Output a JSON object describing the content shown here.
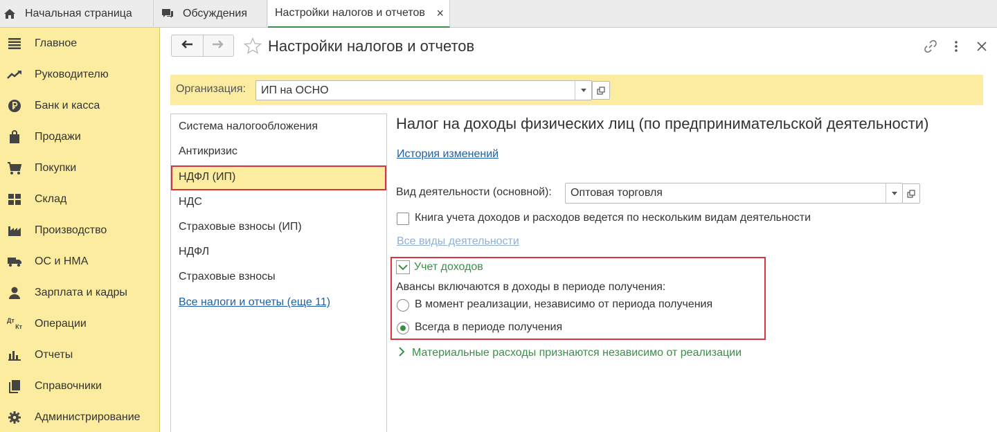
{
  "tabs": {
    "home_label": "Начальная страница",
    "discussions_label": "Обсуждения",
    "active_label": "Настройки налогов и отчетов",
    "close_symbol": "×"
  },
  "sidebar": {
    "items": [
      {
        "label": "Главное",
        "icon": "menu-icon"
      },
      {
        "label": "Руководителю",
        "icon": "trend-icon"
      },
      {
        "label": "Банк и касса",
        "icon": "ruble-icon"
      },
      {
        "label": "Продажи",
        "icon": "bag-icon"
      },
      {
        "label": "Покупки",
        "icon": "cart-icon"
      },
      {
        "label": "Склад",
        "icon": "warehouse-icon"
      },
      {
        "label": "Производство",
        "icon": "factory-icon"
      },
      {
        "label": "ОС и НМА",
        "icon": "truck-icon"
      },
      {
        "label": "Зарплата и кадры",
        "icon": "person-icon"
      },
      {
        "label": "Операции",
        "icon": "dt-kt-icon"
      },
      {
        "label": "Отчеты",
        "icon": "bar-chart-icon"
      },
      {
        "label": "Справочники",
        "icon": "books-icon"
      },
      {
        "label": "Администрирование",
        "icon": "gear-icon"
      }
    ],
    "dt_kt_text_top": "Дт",
    "dt_kt_text_bottom": "Кт"
  },
  "header": {
    "title": "Настройки налогов и отчетов"
  },
  "organization": {
    "label": "Организация:",
    "value": "ИП на ОСНО"
  },
  "left_list": {
    "items": [
      "Система налогообложения",
      "Антикризис",
      "НДФЛ (ИП)",
      "НДС",
      "Страховые взносы (ИП)",
      "НДФЛ",
      "Страховые взносы"
    ],
    "selected_index": 2,
    "more_link": "Все налоги и отчеты (еще 11)"
  },
  "content": {
    "section_title": "Налог на доходы физических лиц (по предпринимательской деятельности)",
    "history_link": "История изменений",
    "activity_label": "Вид деятельности (основной):",
    "activity_value": "Оптовая торговля",
    "multi_activity_checkbox_label": "Книга учета доходов и расходов ведется по нескольким видам деятельности",
    "multi_activity_checked": false,
    "all_activities_link": "Все виды деятельности",
    "income_group": {
      "title": "Учет доходов",
      "expanded": true,
      "advances_label": "Авансы включаются в доходы в периоде получения:",
      "options": [
        {
          "label": "В момент реализации, независимо от периода получения",
          "checked": false
        },
        {
          "label": "Всегда в периоде получения",
          "checked": true
        }
      ]
    },
    "material_group": {
      "title": "Материальные расходы признаются независимо от реализации",
      "expanded": false
    }
  },
  "colors": {
    "sidebar_bg": "#fbec9f",
    "accent_green": "#3a8f48",
    "link_blue": "#1f5fa8",
    "highlight_red": "#d9333f"
  }
}
